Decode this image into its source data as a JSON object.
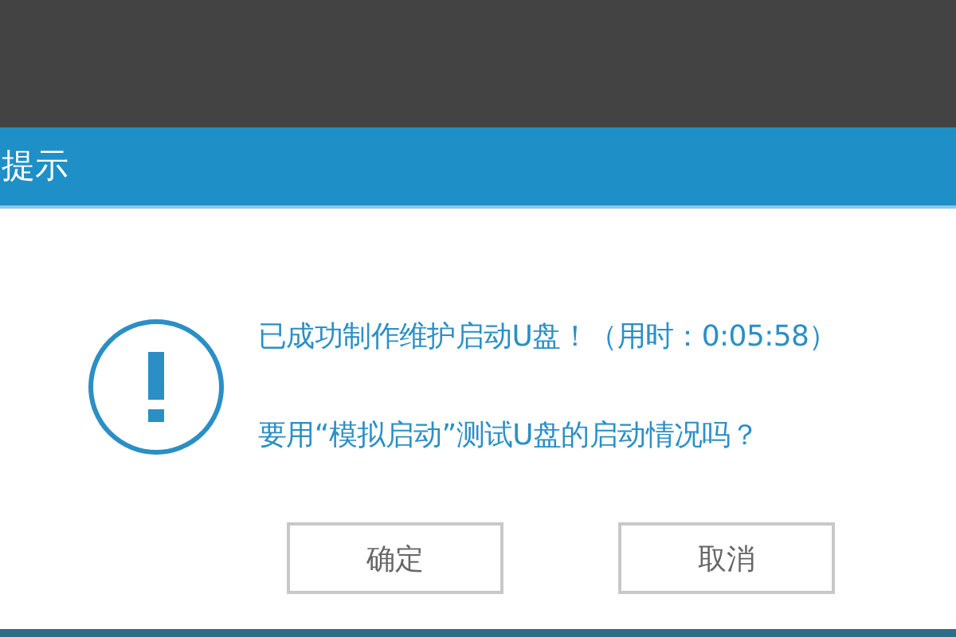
{
  "dialog": {
    "title": "提示",
    "messages": [
      "已成功制作维护启动U盘！（用时：0:05:58）",
      "要用“模拟启动”测试U盘的启动情况吗？"
    ],
    "buttons": [
      {
        "label": "确定"
      },
      {
        "label": "取消"
      }
    ]
  }
}
